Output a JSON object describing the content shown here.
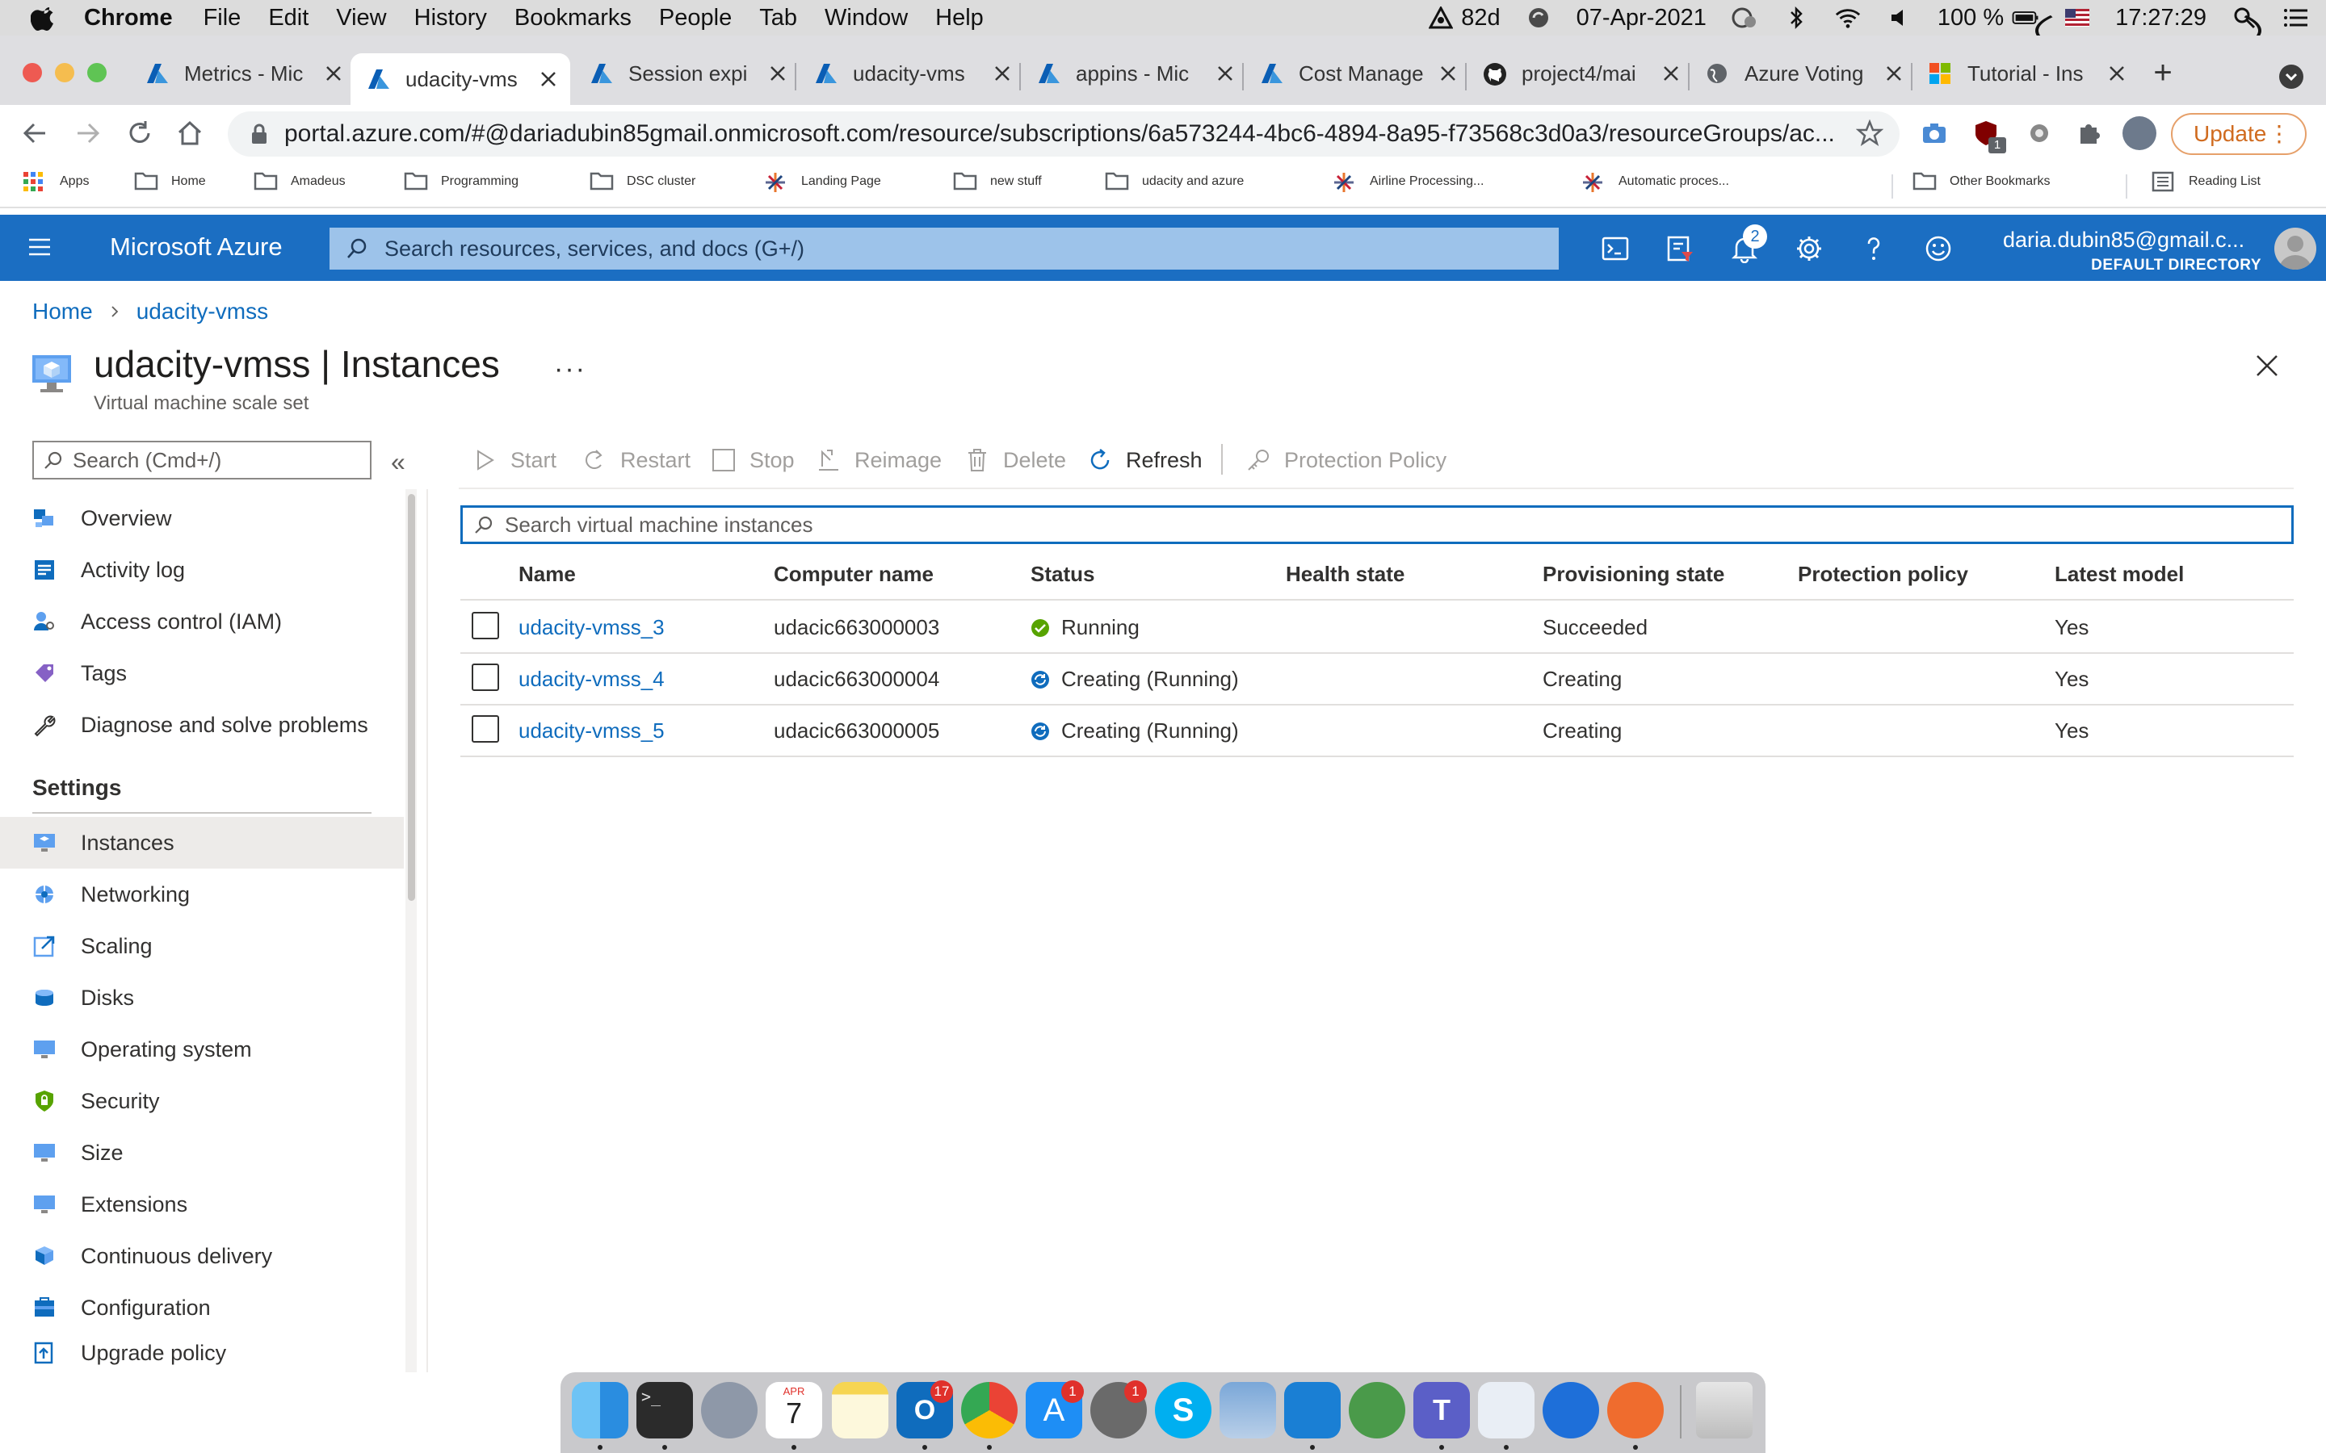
{
  "menubar": {
    "app": "Chrome",
    "items": [
      "File",
      "Edit",
      "View",
      "History",
      "Bookmarks",
      "People",
      "Tab",
      "Window",
      "Help"
    ],
    "status": {
      "temp": "82d",
      "date": "07-Apr-2021",
      "battery": "100 %",
      "time": "17:27:29"
    }
  },
  "tabs": [
    {
      "title": "Metrics - Mic",
      "icon": "azure-icon"
    },
    {
      "title": "udacity-vms",
      "icon": "azure-icon",
      "active": true
    },
    {
      "title": "Session expi",
      "icon": "azure-icon"
    },
    {
      "title": "udacity-vms",
      "icon": "azure-icon"
    },
    {
      "title": "appins - Mic",
      "icon": "azure-icon"
    },
    {
      "title": "Cost Manage",
      "icon": "azure-icon"
    },
    {
      "title": "project4/mai",
      "icon": "github-icon"
    },
    {
      "title": "Azure Voting",
      "icon": "globe-icon"
    },
    {
      "title": "Tutorial - Ins",
      "icon": "microsoft-icon"
    }
  ],
  "toolbar": {
    "url": "portal.azure.com/#@dariadubin85gmail.onmicrosoft.com/resource/subscriptions/6a573244-4bc6-4894-8a95-f73568c3d0a3/resourceGroups/ac...",
    "update_label": "Update",
    "extension_badge": "1"
  },
  "bookmarks": [
    {
      "label": "Apps",
      "icon": "apps-grid-icon"
    },
    {
      "label": "Home",
      "icon": "folder-icon"
    },
    {
      "label": "Amadeus",
      "icon": "folder-icon"
    },
    {
      "label": "Programming",
      "icon": "folder-icon"
    },
    {
      "label": "DSC cluster",
      "icon": "folder-icon"
    },
    {
      "label": "Landing Page",
      "icon": "tableau-icon"
    },
    {
      "label": "new stuff",
      "icon": "folder-icon"
    },
    {
      "label": "udacity and azure",
      "icon": "folder-icon"
    },
    {
      "label": "Airline Processing...",
      "icon": "tableau-icon"
    },
    {
      "label": "Automatic proces...",
      "icon": "tableau-icon"
    },
    {
      "label": "Other Bookmarks",
      "icon": "folder-icon"
    },
    {
      "label": "Reading List",
      "icon": "reading-list-icon"
    }
  ],
  "azure": {
    "brand": "Microsoft Azure",
    "search_placeholder": "Search resources, services, and docs (G+/)",
    "notifications_count": "2",
    "account_name": "daria.dubin85@gmail.c...",
    "account_directory": "DEFAULT DIRECTORY"
  },
  "breadcrumb": [
    "Home",
    "udacity-vmss"
  ],
  "page": {
    "title": "udacity-vmss | Instances",
    "subtitle": "Virtual machine scale set",
    "more": "···"
  },
  "nav": {
    "search_placeholder": "Search (Cmd+/)",
    "collapse": "«",
    "items": [
      {
        "label": "Overview",
        "icon": "overview-icon"
      },
      {
        "label": "Activity log",
        "icon": "activity-log-icon"
      },
      {
        "label": "Access control (IAM)",
        "icon": "iam-icon"
      },
      {
        "label": "Tags",
        "icon": "tag-icon"
      },
      {
        "label": "Diagnose and solve problems",
        "icon": "wrench-icon"
      }
    ],
    "section": "Settings",
    "settings_items": [
      {
        "label": "Instances",
        "icon": "instances-icon",
        "selected": true
      },
      {
        "label": "Networking",
        "icon": "networking-icon"
      },
      {
        "label": "Scaling",
        "icon": "scaling-icon"
      },
      {
        "label": "Disks",
        "icon": "disks-icon"
      },
      {
        "label": "Operating system",
        "icon": "monitor-icon"
      },
      {
        "label": "Security",
        "icon": "shield-icon"
      },
      {
        "label": "Size",
        "icon": "size-icon"
      },
      {
        "label": "Extensions",
        "icon": "extensions-icon"
      },
      {
        "label": "Continuous delivery",
        "icon": "delivery-icon"
      },
      {
        "label": "Configuration",
        "icon": "configuration-icon"
      },
      {
        "label": "Upgrade policy",
        "icon": "upgrade-icon"
      }
    ]
  },
  "commands": [
    {
      "label": "Start",
      "icon": "play-icon",
      "enabled": false
    },
    {
      "label": "Restart",
      "icon": "restart-icon",
      "enabled": false
    },
    {
      "label": "Stop",
      "icon": "stop-icon",
      "enabled": false
    },
    {
      "label": "Reimage",
      "icon": "reimage-icon",
      "enabled": false
    },
    {
      "label": "Delete",
      "icon": "trash-icon",
      "enabled": false
    },
    {
      "label": "Refresh",
      "icon": "refresh-icon",
      "enabled": true
    },
    {
      "label": "Protection Policy",
      "icon": "key-icon",
      "enabled": false
    }
  ],
  "grid": {
    "search_placeholder": "Search virtual machine instances",
    "columns": [
      "Name",
      "Computer name",
      "Status",
      "Health state",
      "Provisioning state",
      "Protection policy",
      "Latest model"
    ],
    "rows": [
      {
        "name": "udacity-vmss_3",
        "computer": "udacic663000003",
        "status": "Running",
        "status_icon": "check-circle-icon",
        "health": "",
        "provisioning": "Succeeded",
        "protection": "",
        "latest": "Yes"
      },
      {
        "name": "udacity-vmss_4",
        "computer": "udacic663000004",
        "status": "Creating (Running)",
        "status_icon": "sync-icon",
        "health": "",
        "provisioning": "Creating",
        "protection": "",
        "latest": "Yes"
      },
      {
        "name": "udacity-vmss_5",
        "computer": "udacic663000005",
        "status": "Creating (Running)",
        "status_icon": "sync-icon",
        "health": "",
        "provisioning": "Creating",
        "protection": "",
        "latest": "Yes"
      }
    ]
  },
  "dock": {
    "apps": [
      "finder",
      "terminal",
      "launchpad",
      "calendar",
      "notes",
      "outlook",
      "chrome",
      "app-store",
      "system-preferences",
      "skype",
      "preview",
      "vscode",
      "vpn",
      "teams",
      "tableau",
      "pin",
      "postman",
      "trash"
    ],
    "calendar_month": "APR",
    "calendar_day": "7",
    "outlook_badge": "17",
    "appstore_badge": "1",
    "syspref_badge": "1"
  },
  "colors": {
    "azure_header": "#1b6ec2",
    "link": "#0f6cbd",
    "running_green": "#57a300",
    "creating_blue": "#0f6cbd"
  }
}
